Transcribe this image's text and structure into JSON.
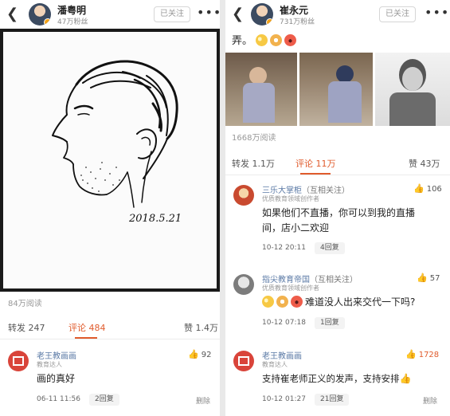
{
  "left": {
    "header": {
      "back_icon": "chevron-left-icon",
      "name": "潘粤明",
      "fans": "47万粉丝",
      "follow": "已关注",
      "more": "•••"
    },
    "reads": "84万阅读",
    "tabs": {
      "repost": "转发 247",
      "comment": "评论 484",
      "like": "赞 1.4万"
    },
    "drawing_date": "2018.5.21",
    "comments": [
      {
        "name": "老王教画画",
        "sub": "教育达人",
        "text": "画的真好",
        "date": "06-11 11:56",
        "reply": "2回复",
        "delete": "删除",
        "likes": "92"
      }
    ]
  },
  "right": {
    "header": {
      "back_icon": "chevron-left-icon",
      "name": "崔永元",
      "fans": "731万粉丝",
      "follow": "已关注",
      "more": "•••"
    },
    "post_text_tail": "弄。",
    "reads": "1668万阅读",
    "tabs": {
      "repost": "转发 1.1万",
      "comment": "评论 11万",
      "like": "赞 43万"
    },
    "comments": [
      {
        "name": "三乐大掌柜",
        "mutual": "（互相关注）",
        "sub": "优质教育领域创作者",
        "text1": "如果他们不直播，你可以到我的直播",
        "text2": "间，店小二欢迎",
        "date": "10-12 20:11",
        "reply": "4回复",
        "likes": "106"
      },
      {
        "name": "指尖教育帝国",
        "mutual": "（互相关注）",
        "sub": "优质教育领域创作者",
        "text": "难道没人出来交代一下吗?",
        "date": "10-12 07:18",
        "reply": "1回复",
        "likes": "57"
      },
      {
        "name": "老王教画画",
        "sub": "教育达人",
        "text": "支持崔老师正义的发声，支持安排",
        "date": "10-12 01:27",
        "reply": "21回复",
        "delete": "删除",
        "likes": "1728"
      }
    ]
  },
  "colors": {
    "accent": "#e05b2c",
    "link": "#5b7aa6"
  }
}
